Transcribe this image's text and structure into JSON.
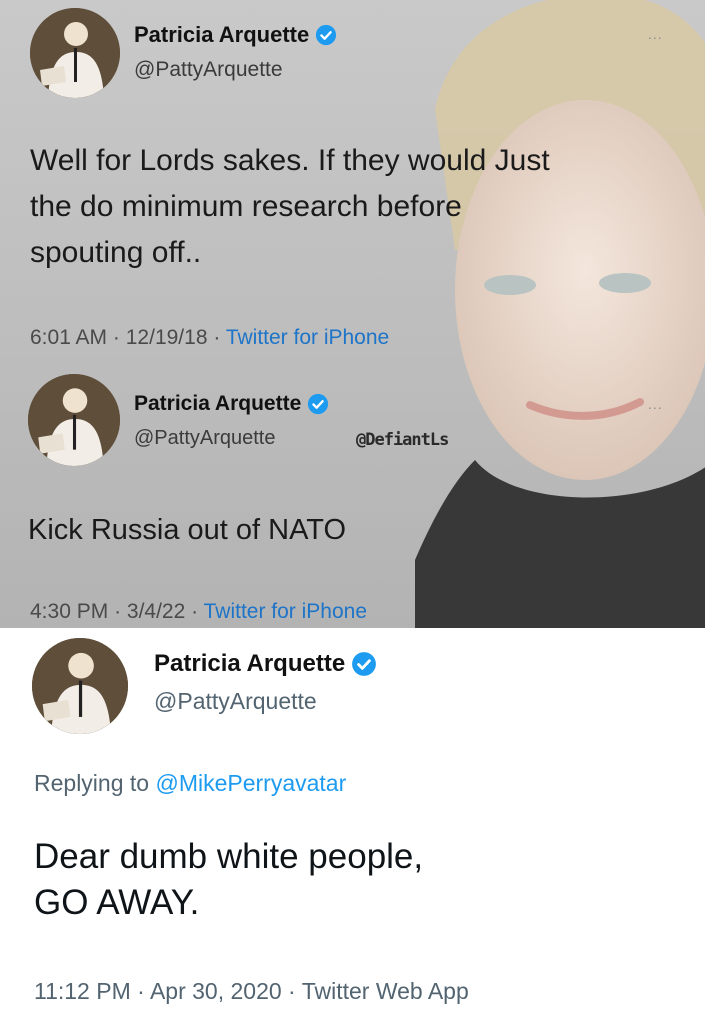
{
  "tweets": [
    {
      "name": "Patricia Arquette",
      "handle": "@PattyArquette",
      "text": "Well for Lords sakes. If they would Just\nthe do minimum research before\nspouting off..",
      "time": "6:01 AM",
      "date": "12/19/18",
      "source": "Twitter for iPhone",
      "menu": "..."
    },
    {
      "name": "Patricia Arquette",
      "handle": "@PattyArquette",
      "watermark": "@DefiantLs",
      "text": "Kick Russia out of NATO",
      "time": "4:30 PM",
      "date": "3/4/22",
      "source": "Twitter for iPhone",
      "menu": "..."
    },
    {
      "name": "Patricia Arquette",
      "handle": "@PattyArquette",
      "replying_label": "Replying to",
      "replying_to": "@MikePerryavatar",
      "text": "Dear dumb white people,\nGO AWAY.",
      "time": "11:12 PM",
      "date": "Apr 30, 2020",
      "source": "Twitter Web App"
    }
  ],
  "separator": "·",
  "colors": {
    "verified": "#1d9bf0",
    "link": "#1d9bf0",
    "muted": "#536471"
  },
  "icons": [
    "verified-badge-icon",
    "more-options-icon",
    "avatar-photo"
  ]
}
